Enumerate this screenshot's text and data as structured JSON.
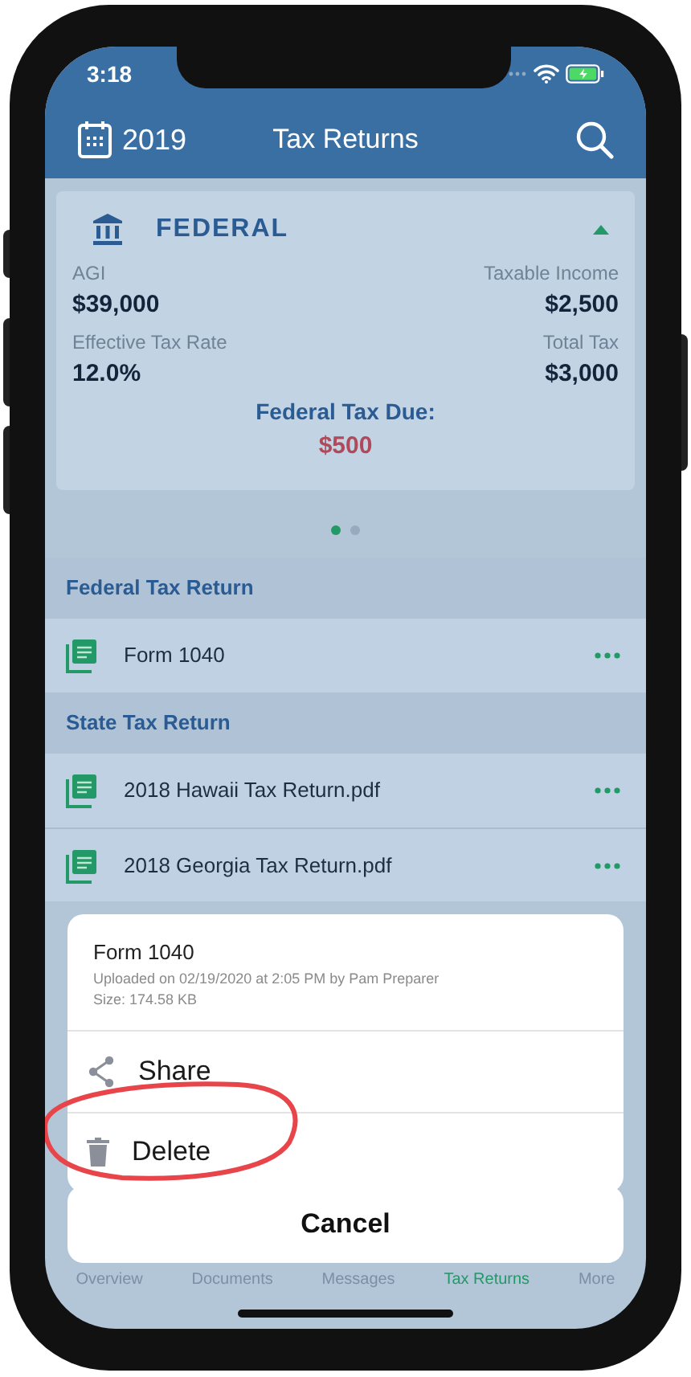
{
  "status_bar": {
    "time": "3:18"
  },
  "nav_bar": {
    "year": "2019",
    "title": "Tax Returns"
  },
  "summary_card": {
    "title": "FEDERAL",
    "expanded": true,
    "stats": [
      {
        "label": "AGI",
        "value": "$39,000"
      },
      {
        "label": "Taxable Income",
        "value": "$2,500"
      },
      {
        "label": "Effective Tax Rate",
        "value": "12.0%"
      },
      {
        "label": "Total Tax",
        "value": "$3,000"
      }
    ],
    "due_label": "Federal Tax Due:",
    "due_value": "$500"
  },
  "pager": [
    {
      "selected": true
    },
    {
      "selected": false
    }
  ],
  "sections": [
    {
      "title": "Federal Tax Return",
      "files": [
        {
          "name": "Form 1040"
        }
      ]
    },
    {
      "title": "State Tax Return",
      "files": [
        {
          "name": "2018 Hawaii Tax Return.pdf"
        },
        {
          "name": "2018 Georgia Tax Return.pdf"
        }
      ]
    }
  ],
  "action_sheet": {
    "file_name": "Form 1040",
    "details": [
      "Uploaded on 02/19/2020 at 2:05 PM by Pam Preparer",
      "Size: 174.58 KB"
    ],
    "actions": [
      {
        "label": "Share",
        "kind": "share"
      },
      {
        "label": "Delete",
        "kind": "delete"
      }
    ],
    "cancel": "Cancel"
  },
  "tab_bar": [
    {
      "label": "Overview",
      "selected": false
    },
    {
      "label": "Documents",
      "selected": false
    },
    {
      "label": "Messages",
      "selected": false
    },
    {
      "label": "Tax Returns",
      "selected": true
    },
    {
      "label": "More",
      "selected": false
    }
  ]
}
